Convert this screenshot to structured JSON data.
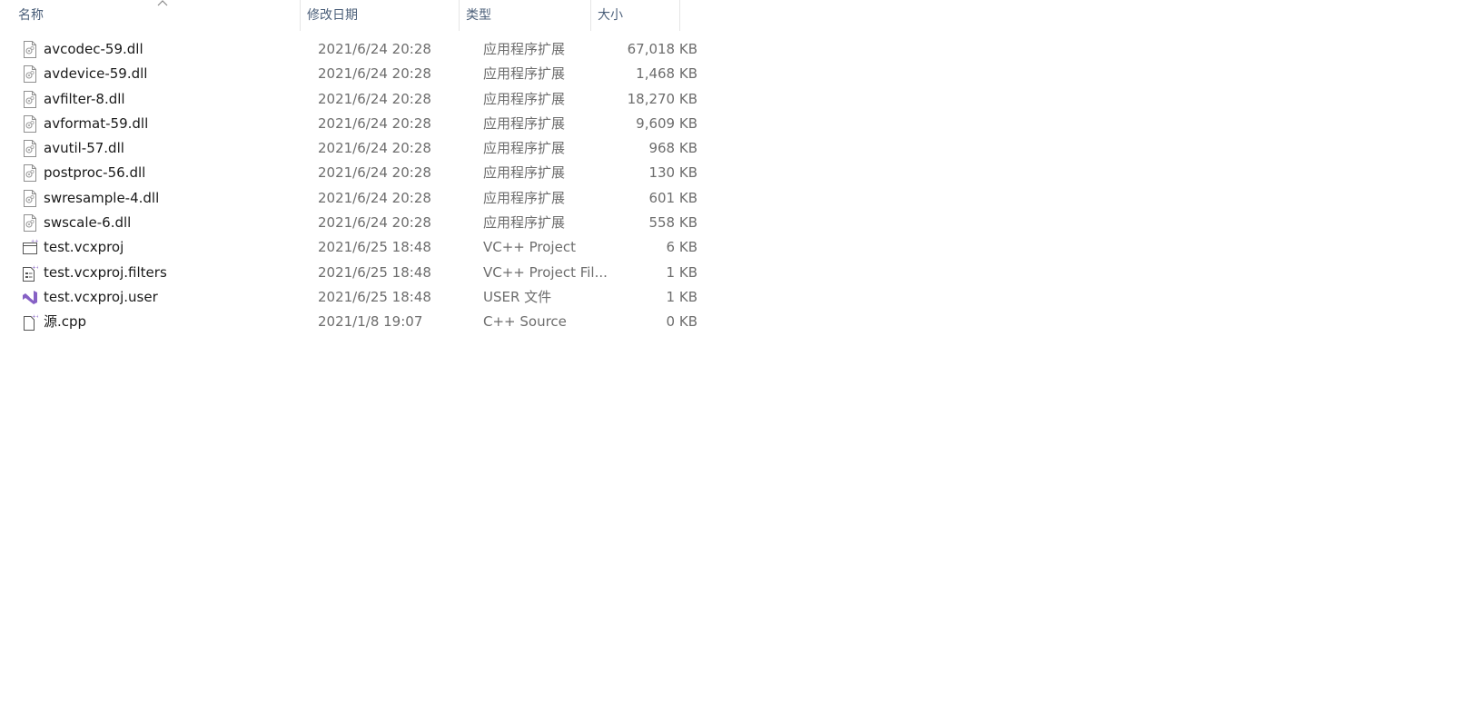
{
  "columns": {
    "name": "名称",
    "modified": "修改日期",
    "type": "类型",
    "size": "大小"
  },
  "colors": {
    "header_text": "#4c607a",
    "secondary_text": "#6d6d6d",
    "vs_purple": "#8661c5"
  },
  "files": [
    {
      "name": "avcodec-59.dll",
      "modified": "2021/6/24 20:28",
      "type": "应用程序扩展",
      "size": "67,018 KB",
      "icon": "dll-file-icon"
    },
    {
      "name": "avdevice-59.dll",
      "modified": "2021/6/24 20:28",
      "type": "应用程序扩展",
      "size": "1,468 KB",
      "icon": "dll-file-icon"
    },
    {
      "name": "avfilter-8.dll",
      "modified": "2021/6/24 20:28",
      "type": "应用程序扩展",
      "size": "18,270 KB",
      "icon": "dll-file-icon"
    },
    {
      "name": "avformat-59.dll",
      "modified": "2021/6/24 20:28",
      "type": "应用程序扩展",
      "size": "9,609 KB",
      "icon": "dll-file-icon"
    },
    {
      "name": "avutil-57.dll",
      "modified": "2021/6/24 20:28",
      "type": "应用程序扩展",
      "size": "968 KB",
      "icon": "dll-file-icon"
    },
    {
      "name": "postproc-56.dll",
      "modified": "2021/6/24 20:28",
      "type": "应用程序扩展",
      "size": "130 KB",
      "icon": "dll-file-icon"
    },
    {
      "name": "swresample-4.dll",
      "modified": "2021/6/24 20:28",
      "type": "应用程序扩展",
      "size": "601 KB",
      "icon": "dll-file-icon"
    },
    {
      "name": "swscale-6.dll",
      "modified": "2021/6/24 20:28",
      "type": "应用程序扩展",
      "size": "558 KB",
      "icon": "dll-file-icon"
    },
    {
      "name": "test.vcxproj",
      "modified": "2021/6/25 18:48",
      "type": "VC++ Project",
      "size": "6 KB",
      "icon": "vcxproj-file-icon"
    },
    {
      "name": "test.vcxproj.filters",
      "modified": "2021/6/25 18:48",
      "type": "VC++ Project Fil...",
      "size": "1 KB",
      "icon": "filters-file-icon"
    },
    {
      "name": "test.vcxproj.user",
      "modified": "2021/6/25 18:48",
      "type": "USER 文件",
      "size": "1 KB",
      "icon": "visual-studio-icon"
    },
    {
      "name": "源.cpp",
      "modified": "2021/1/8 19:07",
      "type": "C++ Source",
      "size": "0 KB",
      "icon": "cpp-file-icon"
    }
  ]
}
